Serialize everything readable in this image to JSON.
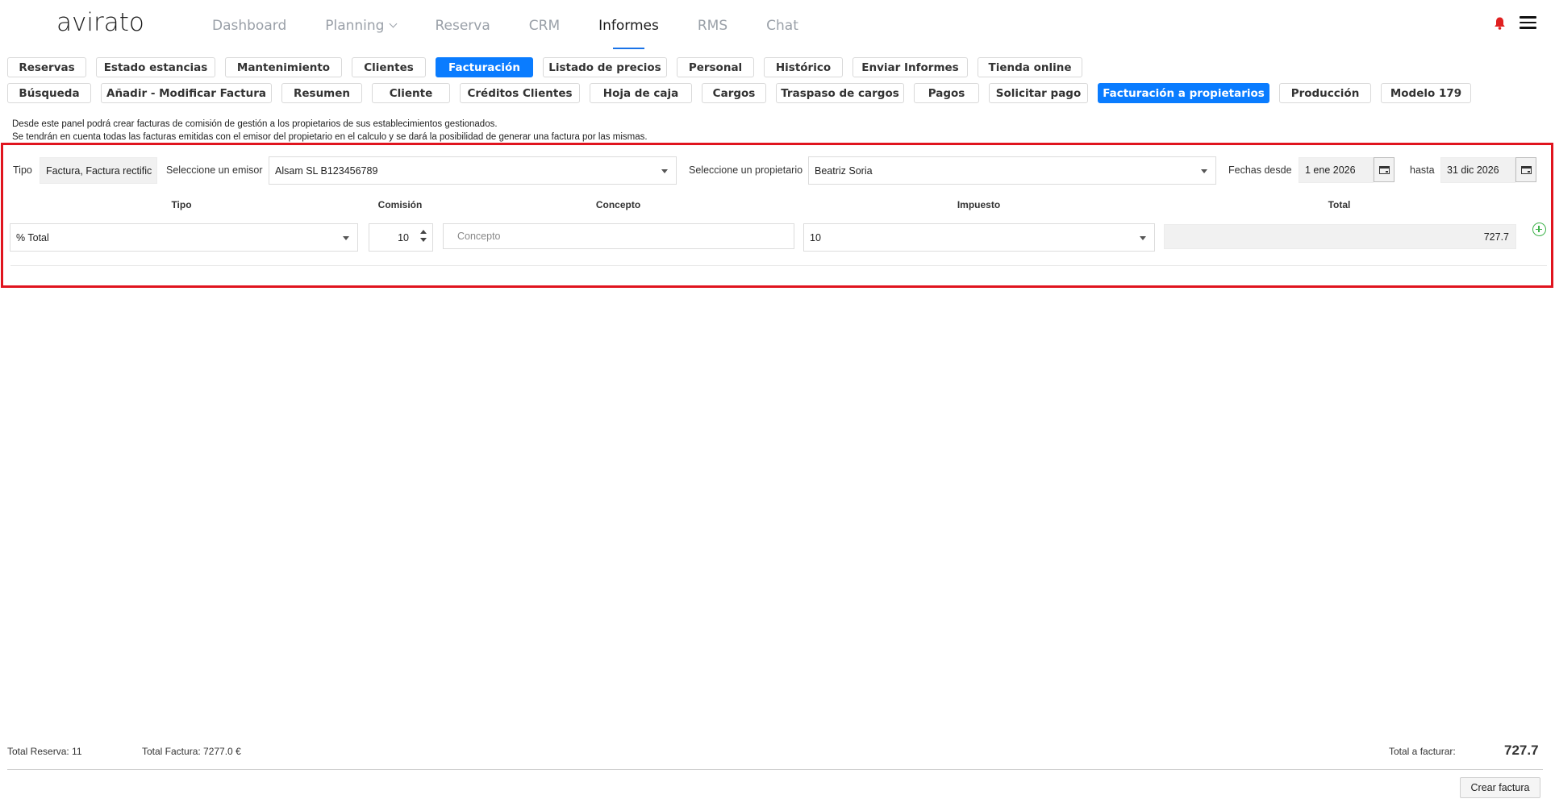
{
  "app": {
    "logo": "avirato"
  },
  "nav": {
    "items": [
      {
        "label": "Dashboard"
      },
      {
        "label": "Planning"
      },
      {
        "label": "Reserva"
      },
      {
        "label": "CRM"
      },
      {
        "label": "Informes"
      },
      {
        "label": "RMS"
      },
      {
        "label": "Chat"
      }
    ],
    "active": "Informes"
  },
  "tabs_row1": [
    "Reservas",
    "Estado estancias",
    "Mantenimiento",
    "Clientes",
    "Facturación",
    "Listado de precios",
    "Personal",
    "Histórico",
    "Enviar Informes",
    "Tienda online"
  ],
  "tabs_row2": [
    "Búsqueda",
    "Añadir - Modificar Factura",
    "Resumen",
    "Cliente",
    "Créditos Clientes",
    "Hoja de caja",
    "Cargos",
    "Traspaso de cargos",
    "Pagos",
    "Solicitar pago",
    "Facturación a propietarios",
    "Producción",
    "Modelo 179"
  ],
  "active_tab_row1": "Facturación",
  "active_tab_row2": "Facturación a propietarios",
  "info": {
    "line1": "Desde este panel podrá crear facturas de comisión de gestión a los propietarios de sus establecimientos gestionados.",
    "line2": "Se tendrán en cuenta todas las facturas emitidas con el emisor del propietario en el calculo y se dará la posibilidad de generar una factura por las mismas."
  },
  "filters": {
    "tipo_label": "Tipo",
    "tipo_value": "Factura, Factura rectific",
    "emisor_label": "Seleccione un emisor",
    "emisor_value": "Alsam SL B123456789",
    "propietario_label": "Seleccione un propietario",
    "propietario_value": "Beatriz Soria",
    "desde_label": "Fechas desde",
    "desde_value": "1 ene 2026",
    "hasta_label": "hasta",
    "hasta_value": "31 dic 2026"
  },
  "columns": {
    "tipo": "Tipo",
    "comision": "Comisión",
    "concepto": "Concepto",
    "impuesto": "Impuesto",
    "total": "Total"
  },
  "row": {
    "tipo": "% Total",
    "comision": "10",
    "concepto_placeholder": "Concepto",
    "impuesto": "10",
    "total": "727.7"
  },
  "footer": {
    "total_reserva": "Total Reserva: 11",
    "total_factura": "Total Factura: 7277.0 €",
    "total_a_facturar_label": "Total a facturar:",
    "total_a_facturar_value": "727.7",
    "crear_button": "Crear factura"
  },
  "colors": {
    "accent": "#0a7cff",
    "highlight_border": "#e0141e",
    "add_icon": "#3db24a",
    "bell": "#e02020"
  }
}
